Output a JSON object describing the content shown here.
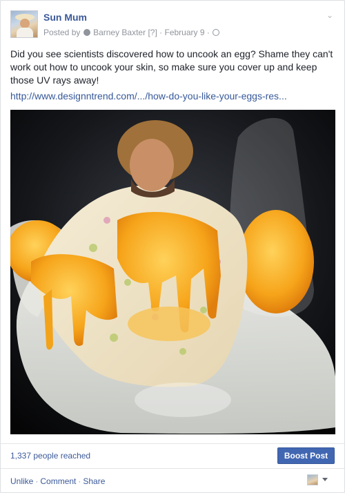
{
  "post": {
    "page_name": "Sun Mum",
    "posted_by_prefix": "Posted by",
    "author": "Barney Baxter",
    "help_marker": "[?]",
    "separator": "·",
    "date": "February 9",
    "text": "Did you see scientists discovered how to uncook an egg? Shame they can't work out how to uncook your skin, so make sure you cover up and keep those UV rays away!",
    "link": "http://www.designntrend.com/.../how-do-you-like-your-eggs-res..."
  },
  "stats": {
    "reach": "1,337 people reached",
    "boost_label": "Boost Post"
  },
  "actions": {
    "unlike": "Unlike",
    "comment": "Comment",
    "share": "Share",
    "separator": "·"
  },
  "icons": {
    "author_badge": "user-icon",
    "audience": "globe-icon",
    "menu": "chevron-down-icon",
    "actor_caret": "caret-icon"
  },
  "colors": {
    "link": "#365899",
    "brand": "#3b5998",
    "button": "#4267b2",
    "meta": "#90949c"
  }
}
